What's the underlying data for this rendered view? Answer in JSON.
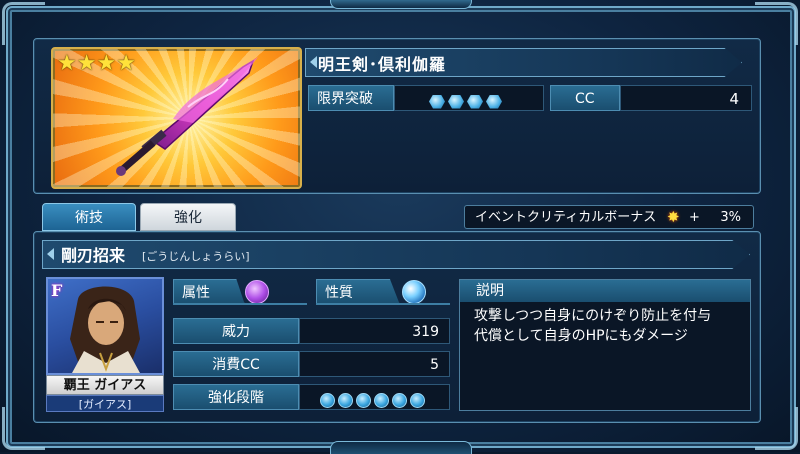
{
  "weapon": {
    "name": "明王剣･倶利伽羅",
    "rarity_stars": 4,
    "limit_break_label": "限界突破",
    "limit_break_level": 4,
    "cc_label": "CC",
    "cc_value": "4"
  },
  "tabs": [
    {
      "label": "術技",
      "active": true
    },
    {
      "label": "強化",
      "active": false
    }
  ],
  "event_bonus": {
    "label": "イベントクリティカルボーナス",
    "icon": "critical-burst-icon",
    "plus": "+",
    "value": "3%"
  },
  "skill": {
    "name": "剛刃招来",
    "reading": "[ごうじんしょうらい]",
    "attribute_label": "属性",
    "attribute_icon": "purple-element-orb-icon",
    "nature_label": "性質",
    "nature_icon": "blue-nature-orb-icon",
    "stats": [
      {
        "label": "威力",
        "value": "319"
      },
      {
        "label": "消費CC",
        "value": "5"
      },
      {
        "label": "強化段階",
        "enhance_level": 6
      }
    ],
    "description_label": "説明",
    "description_lines": [
      "攻撃しつつ自身にのけぞり防止を付与",
      "代償として自身のHPにもダメージ"
    ]
  },
  "character": {
    "rank_badge": "F",
    "name": "覇王 ガイアス",
    "sub_name": "[ガイアス]"
  },
  "colors": {
    "accent": "#2a6d93",
    "frame": "#6fa9c9",
    "card_gold": "#ffc93a",
    "sword_magenta": "#e040c8"
  }
}
